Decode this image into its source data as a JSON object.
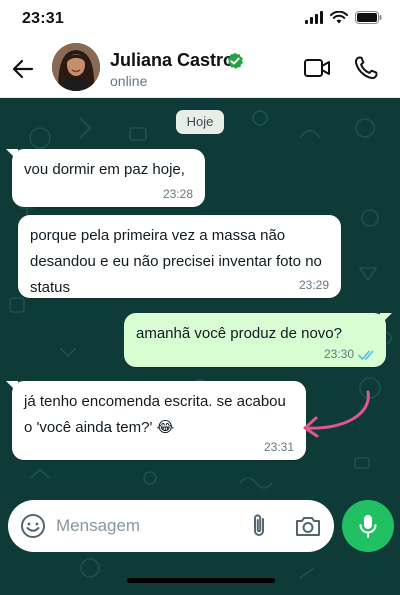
{
  "status_bar": {
    "time": "23:31"
  },
  "header": {
    "contact_name": "Juliana Castro",
    "contact_status": "online",
    "icons": [
      "back-arrow-icon",
      "verified-badge-icon",
      "video-call-icon",
      "phone-call-icon"
    ]
  },
  "chat": {
    "date_chip": "Hoje",
    "messages": [
      {
        "direction": "in",
        "text": "vou dormir em paz hoje,",
        "time": "23:28"
      },
      {
        "direction": "in",
        "text": "porque pela primeira vez a massa não desandou e eu não precisei inventar foto no status",
        "time": "23:29"
      },
      {
        "direction": "out",
        "text": "amanhã você produz de novo?",
        "time": "23:30",
        "read": true
      },
      {
        "direction": "in",
        "text": "já tenho encomenda escrita. se acabou o 'você ainda tem?' 😂",
        "time": "23:31"
      }
    ]
  },
  "composer": {
    "placeholder": "Mensagem",
    "icons": [
      "emoji-icon",
      "attach-icon",
      "camera-icon",
      "microphone-icon"
    ]
  },
  "colors": {
    "wallpaper": "#0e3b37",
    "incoming_bubble": "#ffffff",
    "outgoing_bubble": "#d9fdd3",
    "mic_button": "#21c063",
    "verified": "#25a244",
    "read_ticks": "#53bdeb",
    "annotation_arrow": "#e0578f"
  }
}
